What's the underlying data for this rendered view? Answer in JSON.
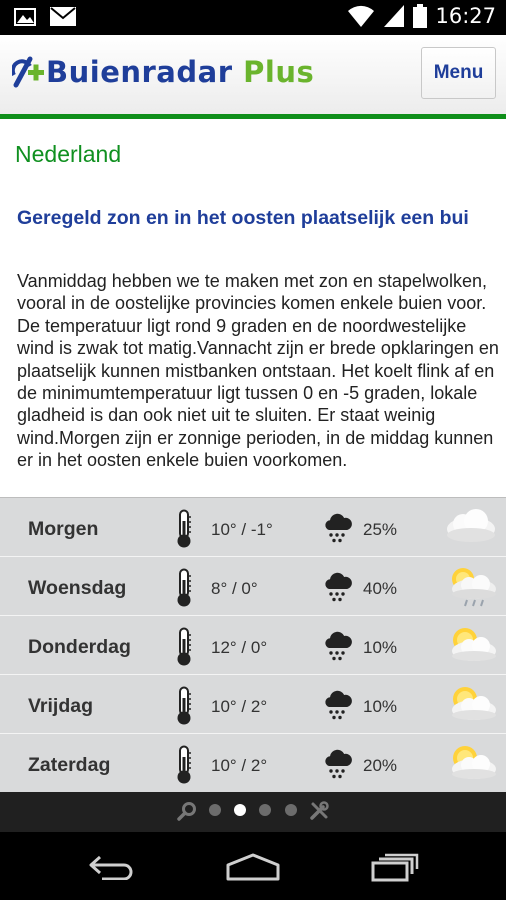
{
  "status_bar": {
    "time": "16:27",
    "icons": [
      "image-icon",
      "mail-icon",
      "wifi-icon",
      "signal-icon",
      "battery-icon"
    ]
  },
  "header": {
    "logo_main": "Buienradar",
    "logo_plus": "Plus",
    "menu_label": "Menu",
    "colors": {
      "brand_blue": "#1f3e9a",
      "brand_green": "#6ab42d",
      "accent_line": "#0f8f1a"
    }
  },
  "content": {
    "region": "Nederland",
    "headline": "Geregeld zon en in het oosten plaatselijk een bui",
    "body": "Vanmiddag hebben we te maken met zon en stapelwolken, vooral in de oostelijke provincies komen enkele buien voor. De temperatuur ligt rond 9 graden en de noordwestelijke wind is zwak tot matig.Vannacht zijn er brede opklaringen en plaatselijk kunnen mistbanken ontstaan. Het koelt flink af en de minimumtemperatuur ligt tussen 0 en -5 graden, lokale gladheid is dan ook niet uit te sluiten. Er staat weinig wind.Morgen zijn er zonnige perioden, in de middag kunnen er in het oosten enkele buien voorkomen."
  },
  "forecast": [
    {
      "day": "Morgen",
      "temp": "10° / -1°",
      "rain": "25%",
      "icon": "cloudy-icon"
    },
    {
      "day": "Woensdag",
      "temp": "8° / 0°",
      "rain": "40%",
      "icon": "partly-cloudy-rain-icon"
    },
    {
      "day": "Donderdag",
      "temp": "12° / 0°",
      "rain": "10%",
      "icon": "partly-sunny-icon"
    },
    {
      "day": "Vrijdag",
      "temp": "10° / 2°",
      "rain": "10%",
      "icon": "partly-sunny-icon"
    },
    {
      "day": "Zaterdag",
      "temp": "10° / 2°",
      "rain": "20%",
      "icon": "partly-sunny-icon"
    }
  ],
  "pager": {
    "items": [
      "search-icon",
      "page-dot",
      "page-dot",
      "page-dot",
      "page-dot",
      "settings-tools-icon"
    ],
    "active_index": 2
  },
  "nav_bar": {
    "icons": [
      "back-icon",
      "home-icon",
      "recent-apps-icon"
    ]
  }
}
